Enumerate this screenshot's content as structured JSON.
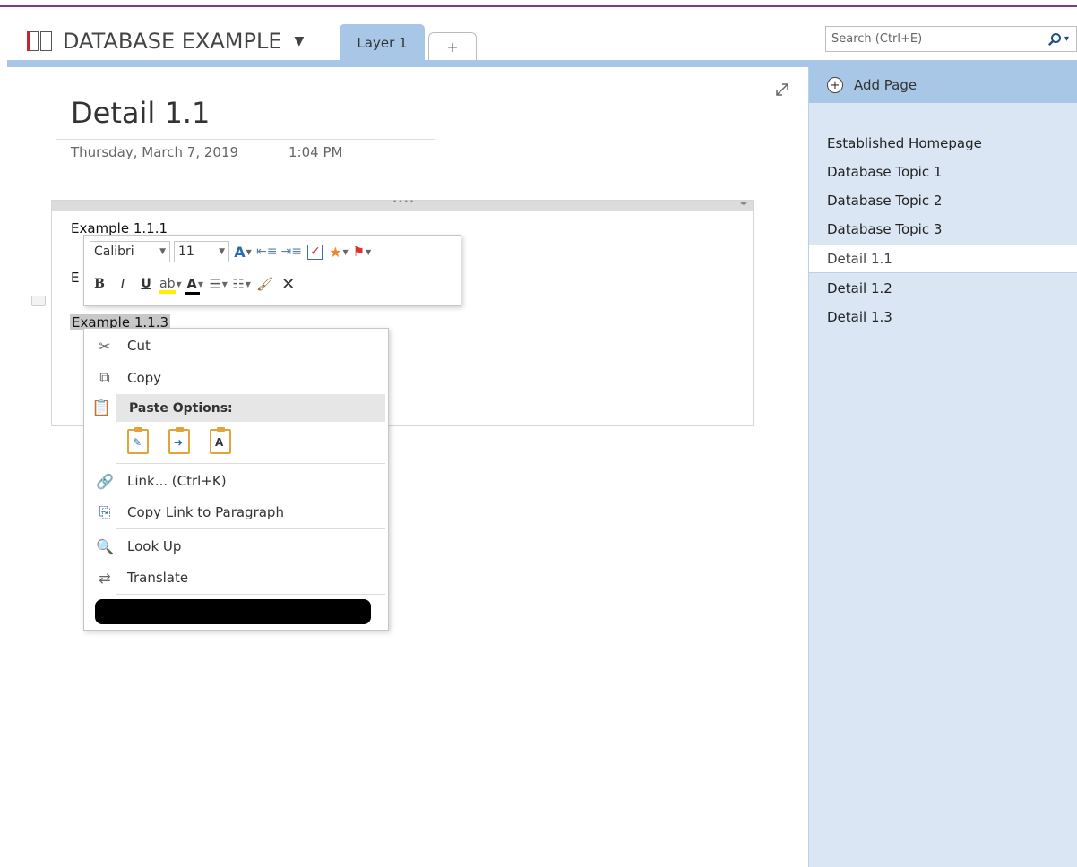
{
  "header": {
    "notebook_name": "DATABASE EXAMPLE",
    "tabs": [
      {
        "label": "Layer 1",
        "active": true
      },
      {
        "label": "+",
        "active": false
      }
    ],
    "search": {
      "placeholder": "Search (Ctrl+E)",
      "value": ""
    },
    "accent": "#a8c6e6",
    "brand": "#7a3b86"
  },
  "page": {
    "title": "Detail 1.1",
    "date": "Thursday, March 7, 2019",
    "time": "1:04 PM",
    "lines": [
      "Example 1.1.1",
      "E",
      "Example 1.1.3"
    ]
  },
  "mini_toolbar": {
    "font_name": "Calibri",
    "font_size": "11",
    "bold": "B",
    "italic": "I",
    "underline": "U",
    "font_color": "A"
  },
  "context_menu": {
    "items": [
      {
        "label": "Cut",
        "icon": "scissors-icon"
      },
      {
        "label": "Copy",
        "icon": "copy-icon"
      },
      {
        "label": "Paste Options:",
        "icon": "clipboard-icon"
      },
      {
        "label": "Link...  (Ctrl+K)",
        "icon": "link-icon"
      },
      {
        "label": "Copy Link to Paragraph",
        "icon": "copy-link-icon"
      },
      {
        "label": "Look Up",
        "icon": "lookup-icon"
      },
      {
        "label": "Translate",
        "icon": "translate-icon"
      }
    ],
    "paste_options": [
      "keep-formatting",
      "merge-formatting",
      "keep-text-only"
    ],
    "paste_text_option": "A"
  },
  "right_pane": {
    "add_page_label": "Add Page",
    "pages": [
      {
        "label": "Established Homepage",
        "selected": false
      },
      {
        "label": "Database Topic 1",
        "selected": false
      },
      {
        "label": "Database Topic 2",
        "selected": false
      },
      {
        "label": "Database Topic 3",
        "selected": false
      },
      {
        "label": "Detail 1.1",
        "selected": true
      },
      {
        "label": "Detail 1.2",
        "selected": false
      },
      {
        "label": "Detail 1.3",
        "selected": false
      }
    ]
  }
}
